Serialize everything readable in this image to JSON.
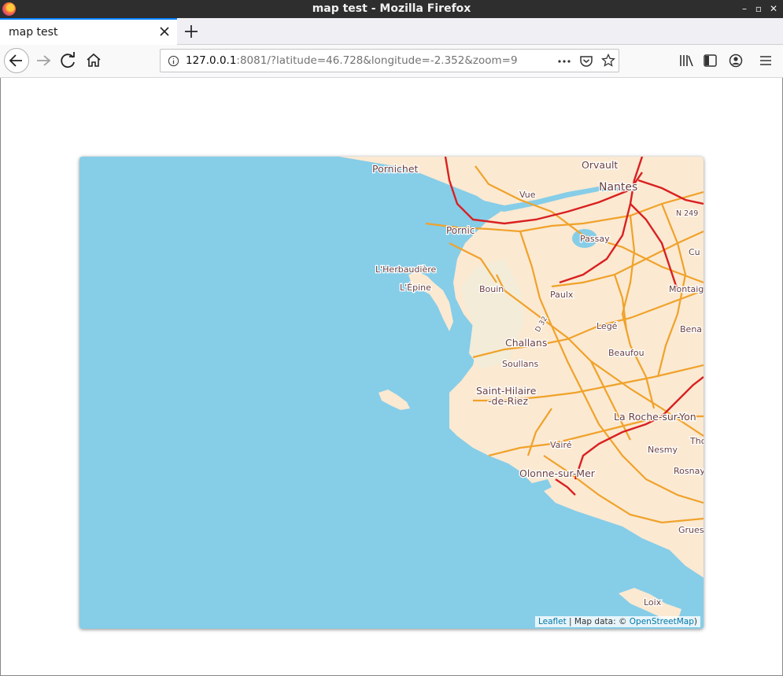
{
  "window": {
    "title": "map test - Mozilla Firefox"
  },
  "tabs": [
    {
      "label": "map test"
    }
  ],
  "navbar": {
    "url_host": "127.0.0.1",
    "url_rest": ":8081/?latitude=46.728&longitude=-2.352&zoom=9"
  },
  "map": {
    "places": {
      "pornichet": "Pornichet",
      "orvault": "Orvault",
      "nantes": "Nantes",
      "vue": "Vue",
      "n249": "N 249",
      "pornic": "Pornic",
      "passay": "Passay",
      "cu": "Cu",
      "herbaudiere": "L'Herbaudière",
      "epine": "L'Épine",
      "bouin": "Bouin",
      "paulx": "Paulx",
      "montaig": "Montaig",
      "d32": "D 32",
      "lege": "Legé",
      "bena": "Bena",
      "challans": "Challans",
      "beaufou": "Beaufou",
      "soullans": "Soullans",
      "sthilaire1": "Saint-Hilaire",
      "sthilaire2": "-de-Riez",
      "larochesuryon": "La Roche-sur-Yon",
      "vaire": "Vairé",
      "nesmy": "Nesmy",
      "tho": "Tho",
      "olonne": "Olonne-sur-Mer",
      "rosnay": "Rosnay",
      "grues": "Grues",
      "loix": "Loix"
    },
    "colors": {
      "water": "#aad3df",
      "land": "#f2efe9",
      "land_warm": "#fbe6cf",
      "primary_road": "#e8a01b",
      "trunk_road": "#d41a1a"
    }
  },
  "attribution": {
    "leaflet": "Leaflet",
    "sep": " | Map data: © ",
    "osm": "OpenStreetMap",
    "close": ")"
  }
}
